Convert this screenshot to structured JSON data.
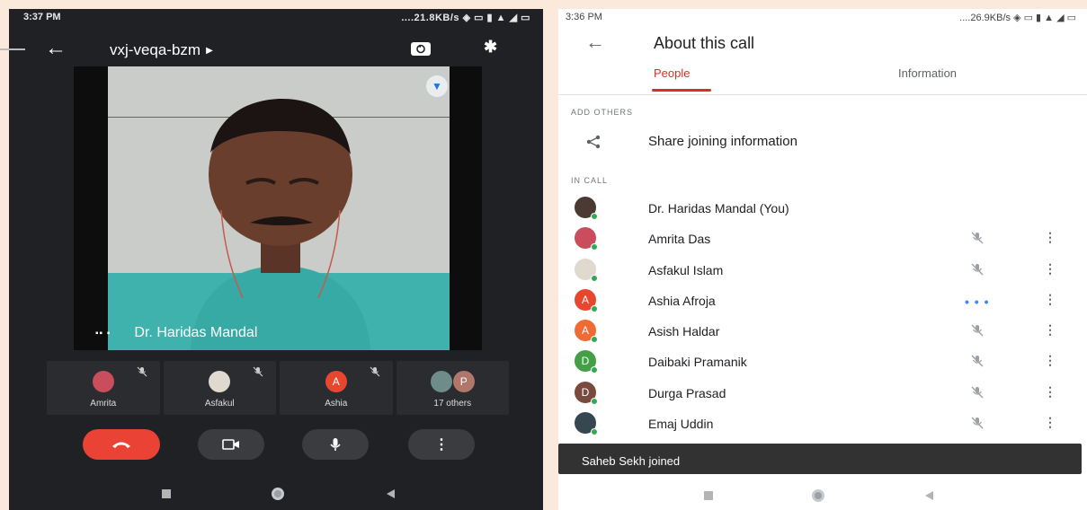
{
  "left_phone": {
    "status": {
      "time": "3:37 PM",
      "right_text": "....21.8KB/s"
    },
    "meeting_code": "vxj-veqa-bzm",
    "main_speaker": "Dr. Haridas Mandal",
    "tiles": [
      {
        "name": "Amrita",
        "avatar_letter": "",
        "avatar_color": "#c94d5c"
      },
      {
        "name": "Asfakul",
        "avatar_letter": "",
        "avatar_color": "#e0d9cf"
      },
      {
        "name": "Ashia",
        "avatar_letter": "A",
        "avatar_color": "#e8472f"
      },
      {
        "name": "17 others",
        "avatar_letter": "P",
        "avatar_color": "#b0776a"
      }
    ]
  },
  "right_phone": {
    "status": {
      "time": "3:36 PM",
      "right_text": "....26.9KB/s"
    },
    "title": "About this call",
    "tabs": {
      "people": "People",
      "information": "Information"
    },
    "add_others_header": "ADD OTHERS",
    "share_label": "Share joining information",
    "in_call_header": "IN CALL",
    "participants": [
      {
        "name": "Dr. Haridas Mandal (You)",
        "avatar_letter": "",
        "avatar_color": "#4a3a33",
        "state": "none"
      },
      {
        "name": "Amrita Das",
        "avatar_letter": "",
        "avatar_color": "#c94d5c",
        "state": "muted"
      },
      {
        "name": "Asfakul Islam",
        "avatar_letter": "",
        "avatar_color": "#e0d9cf",
        "state": "muted"
      },
      {
        "name": "Ashia Afroja",
        "avatar_letter": "A",
        "avatar_color": "#e8472f",
        "state": "speaking"
      },
      {
        "name": "Asish Haldar",
        "avatar_letter": "A",
        "avatar_color": "#f06a35",
        "state": "muted"
      },
      {
        "name": "Daibaki Pramanik",
        "avatar_letter": "D",
        "avatar_color": "#43a047",
        "state": "muted"
      },
      {
        "name": "Durga Prasad",
        "avatar_letter": "D",
        "avatar_color": "#7b4a3f",
        "state": "muted"
      },
      {
        "name": "Emaj Uddin",
        "avatar_letter": "",
        "avatar_color": "#37474f",
        "state": "muted"
      }
    ],
    "toast": "Saheb Sekh joined"
  },
  "colors": {
    "end_call": "#ea4335",
    "accent_red": "#d93025",
    "online_dot": "#34a853"
  },
  "icons": [
    "back-arrow-icon",
    "switch-camera-icon",
    "bluetooth-icon",
    "pin-icon",
    "mic-off-icon",
    "end-call-icon",
    "camera-icon",
    "mic-icon",
    "more-vert-icon",
    "share-icon"
  ]
}
